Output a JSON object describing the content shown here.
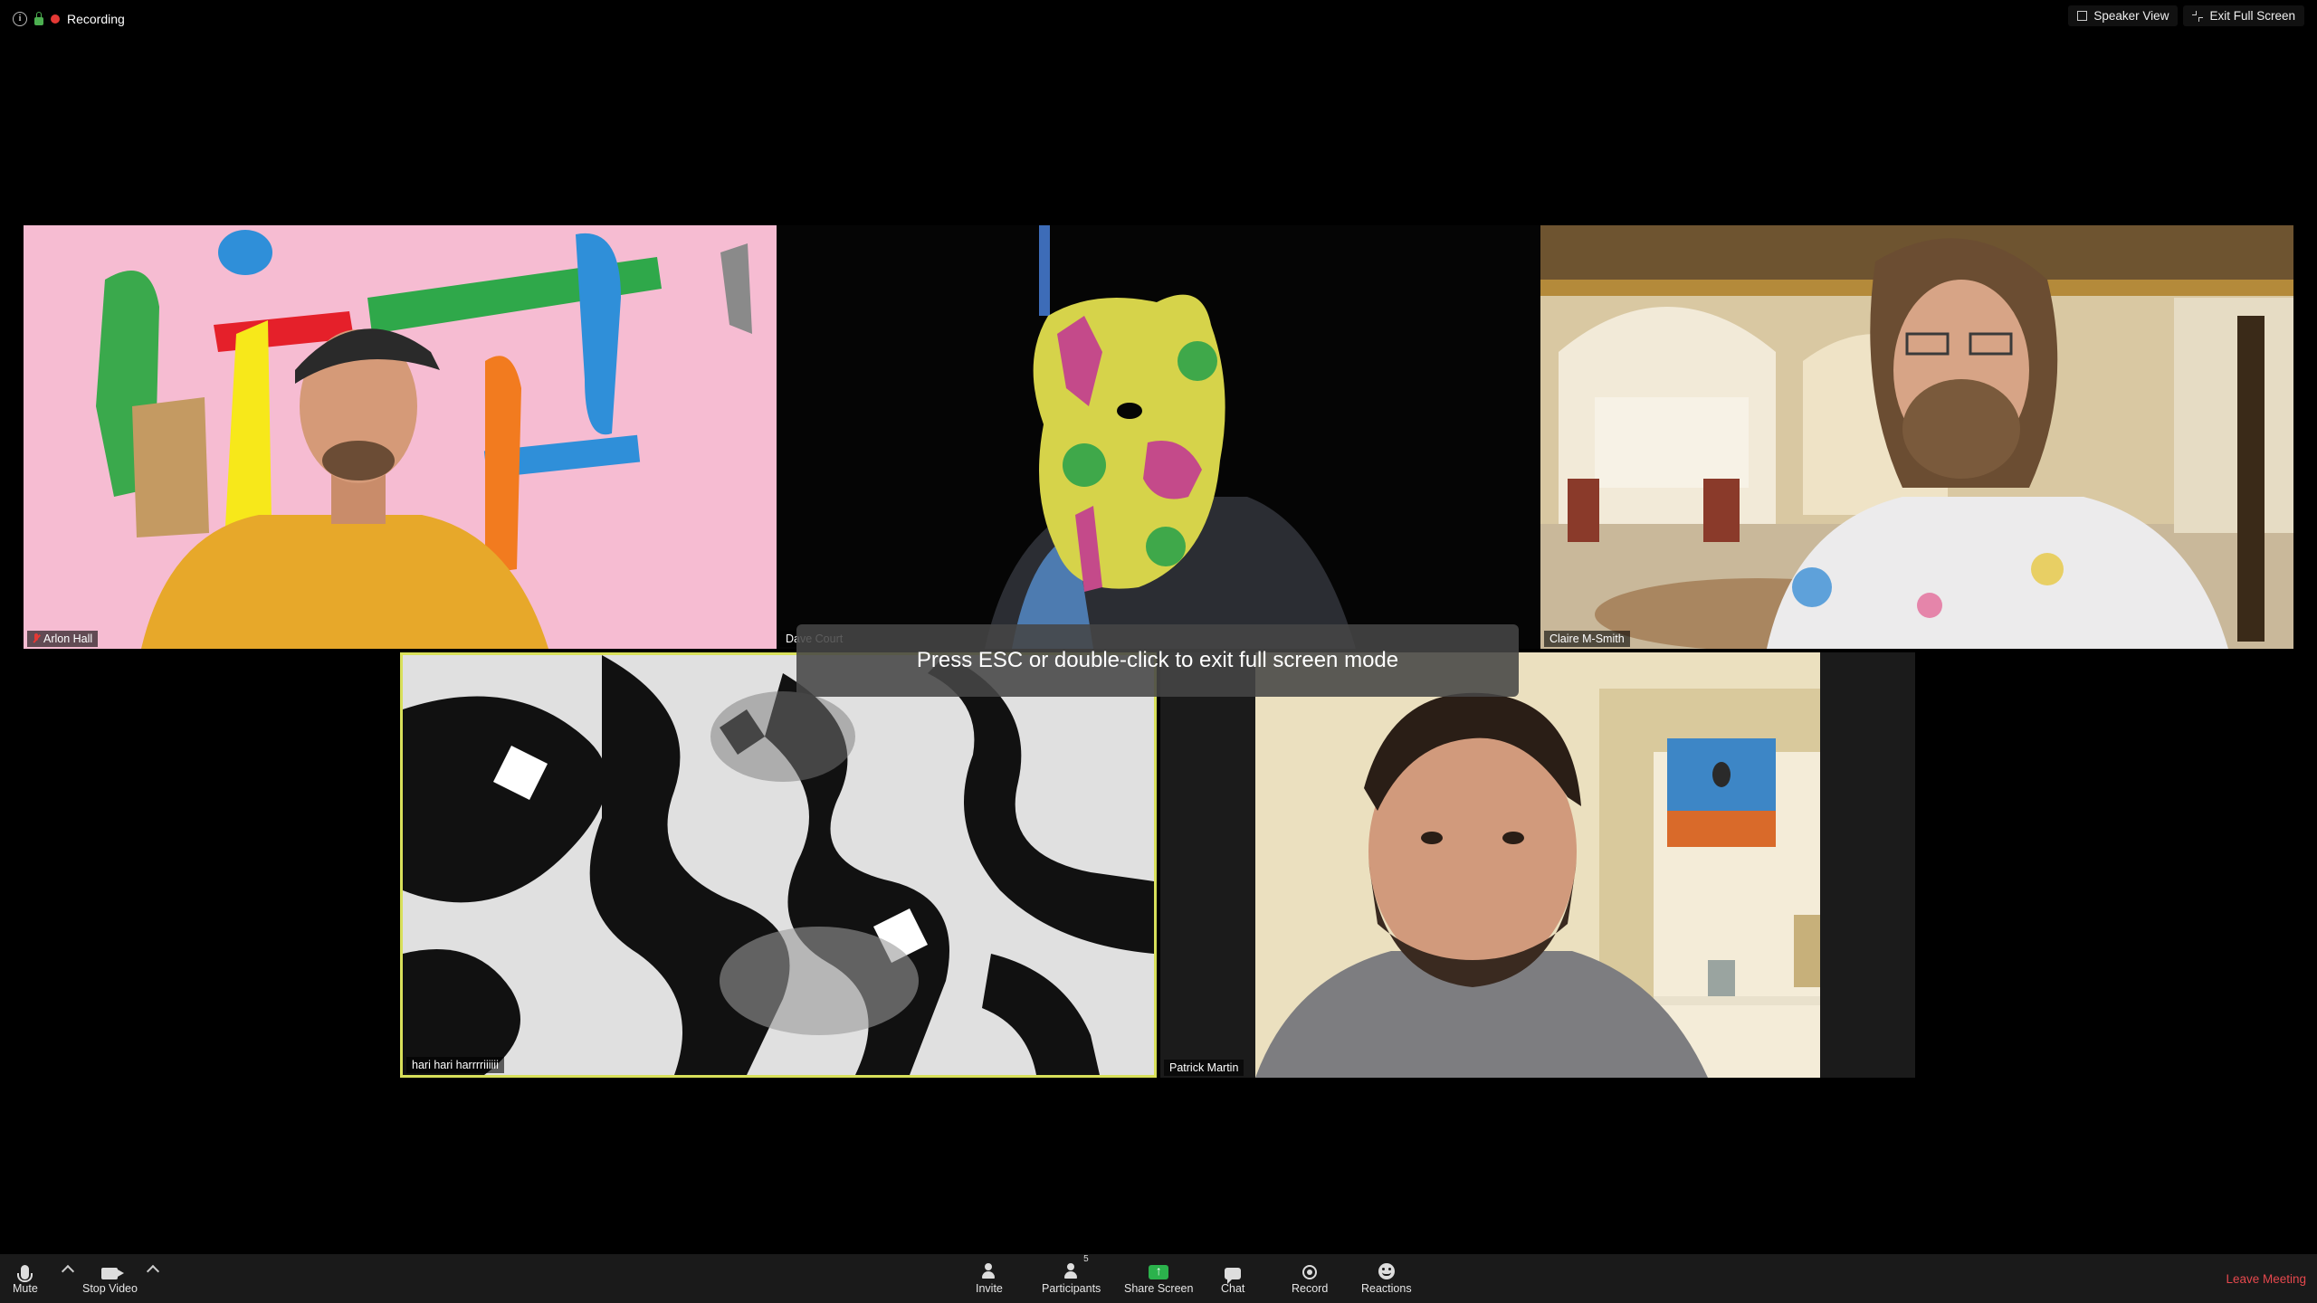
{
  "status_bar": {
    "recording_label": "Recording"
  },
  "view_controls": {
    "speaker_view_label": "Speaker View",
    "exit_full_screen_label": "Exit Full Screen"
  },
  "participants": [
    {
      "name": "Arlon Hall",
      "muted": true
    },
    {
      "name": "Dave Court",
      "muted": false
    },
    {
      "name": "Claire M-Smith",
      "muted": false
    },
    {
      "name": "hari hari harrrriiiiii",
      "muted": false,
      "active_speaker": true
    },
    {
      "name": "Patrick Martin",
      "muted": false
    }
  ],
  "overlay": {
    "message": "Press ESC or double-click to exit full screen mode"
  },
  "toolbar": {
    "mute_label": "Mute",
    "stop_video_label": "Stop Video",
    "invite_label": "Invite",
    "participants_label": "Participants",
    "participants_count": "5",
    "share_screen_label": "Share Screen",
    "chat_label": "Chat",
    "record_label": "Record",
    "reactions_label": "Reactions",
    "leave_label": "Leave Meeting"
  },
  "colors": {
    "background": "#000000",
    "toolbar": "#1a1a1a",
    "active_speaker_border": "#d8e05a",
    "leave": "#e5484d",
    "share": "#2bb24c",
    "recording_dot": "#e53935"
  }
}
